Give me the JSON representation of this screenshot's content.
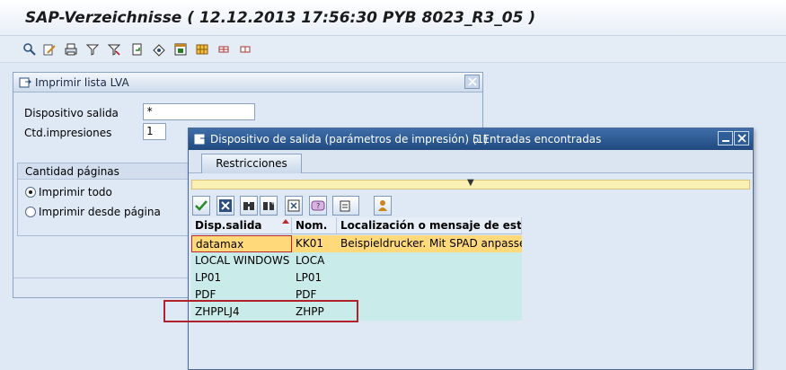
{
  "app": {
    "title": "SAP-Verzeichnisse ( 12.12.2013 17:56:30 PYB 8023_R3_05 )"
  },
  "toolbar": {
    "icons": [
      "detail-icon",
      "edit-icon",
      "print-icon",
      "filter-icon",
      "find-icon",
      "export-icon",
      "select-icon",
      "layout-icon",
      "grid-icon",
      "grid-small-icon"
    ]
  },
  "dialog_print": {
    "title": "Imprimir lista LVA",
    "device_label": "Dispositivo salida",
    "device_value": "*",
    "copies_label": "Ctd.impresiones",
    "copies_value": "1",
    "pages_group_title": "Cantidad páginas",
    "print_all_label": "Imprimir todo",
    "print_from_label": "Imprimir desde página"
  },
  "dialog_device": {
    "title": "Dispositivo de salida (parámetros de impresión) (1)",
    "count": "5 Entradas encontradas",
    "tab_label": "Restricciones",
    "columns": [
      "Disp.salida",
      "Nom.",
      "Localización o mensaje de esta"
    ],
    "rows": [
      [
        "datamax",
        "KK01",
        "Beispieldrucker. Mit SPAD anpassen."
      ],
      [
        "LOCAL WINDOWS",
        "LOCA",
        ""
      ],
      [
        "LP01",
        "LP01",
        ""
      ],
      [
        "PDF",
        "PDF",
        ""
      ],
      [
        "ZHPPLJ4",
        "ZHPP",
        ""
      ]
    ]
  },
  "colors": {
    "selected_row": "#ffd97a",
    "normal_row": "#c9ebe9",
    "highlight_box": "#b22029",
    "title_blue": "#204a80"
  }
}
